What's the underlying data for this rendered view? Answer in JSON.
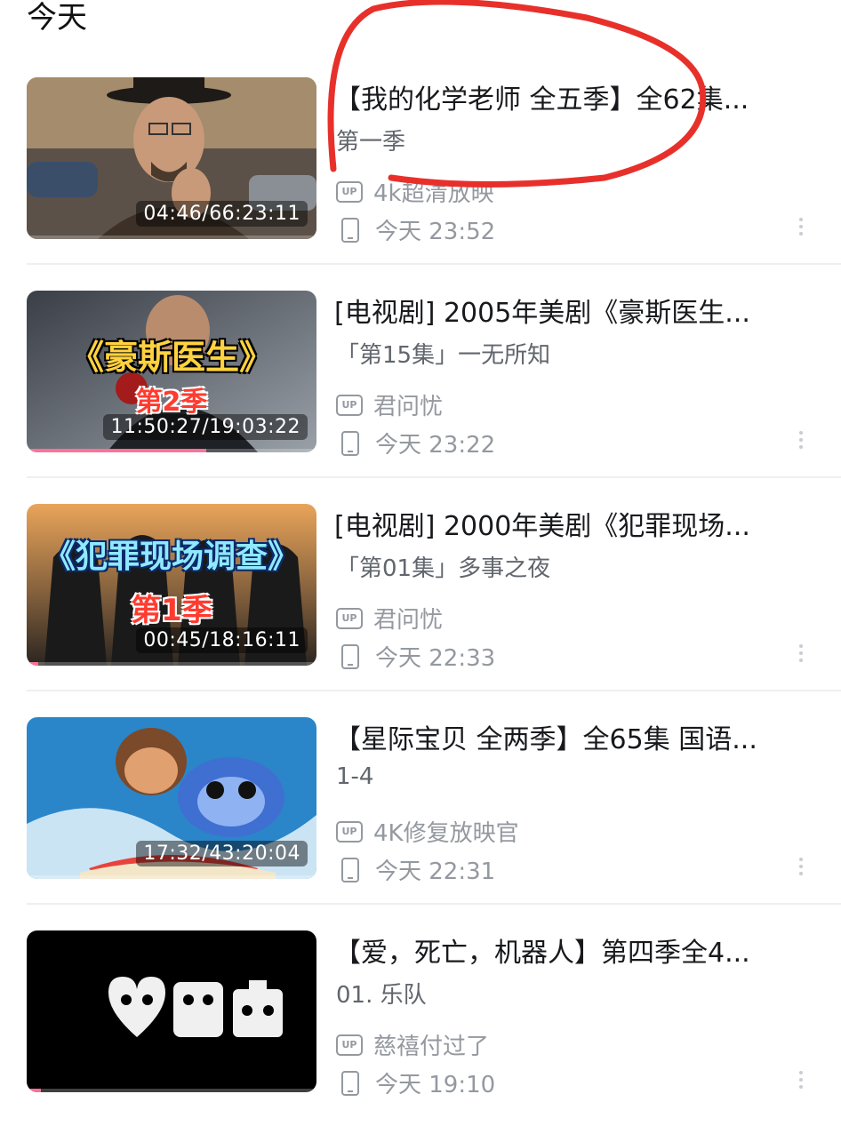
{
  "section": {
    "title": "今天"
  },
  "items": [
    {
      "title": "【我的化学老师 全五季】全62集...",
      "subtitle": "第一季",
      "uploader": "4k超清放映",
      "watched": "今天 23:52",
      "time": "04:46/66:23:11",
      "progress": 0.012,
      "thumb_overlay": "",
      "thumb_overlay2": ""
    },
    {
      "title": "[电视剧] 2005年美剧《豪斯医生...",
      "subtitle": "「第15集」一无所知",
      "uploader": "君问忧",
      "watched": "今天 23:22",
      "time": "11:50:27/19:03:22",
      "progress": 0.62,
      "thumb_overlay": "《豪斯医生》",
      "thumb_overlay2": "第2季"
    },
    {
      "title": "[电视剧] 2000年美剧《犯罪现场...",
      "subtitle": "「第01集」多事之夜",
      "uploader": "君问忧",
      "watched": "今天 22:33",
      "time": "00:45/18:16:11",
      "progress": 0.04,
      "thumb_overlay": "《犯罪现场调查》",
      "thumb_overlay2": "第1季"
    },
    {
      "title": "【星际宝贝 全两季】全65集 国语...",
      "subtitle": "1-4",
      "uploader": "4K修复放映官",
      "watched": "今天 22:31",
      "time": "17:32/43:20:04",
      "progress": 0.007,
      "thumb_overlay": "",
      "thumb_overlay2": ""
    },
    {
      "title": "【爱，死亡，机器人】第四季全4...",
      "subtitle": "01. 乐队",
      "uploader": "慈禧付过了",
      "watched": "今天 19:10",
      "time": "",
      "progress": 0.05,
      "thumb_overlay": "",
      "thumb_overlay2": ""
    }
  ],
  "colors": {
    "progress": "#fb7299",
    "annotation": "#e8302b"
  }
}
